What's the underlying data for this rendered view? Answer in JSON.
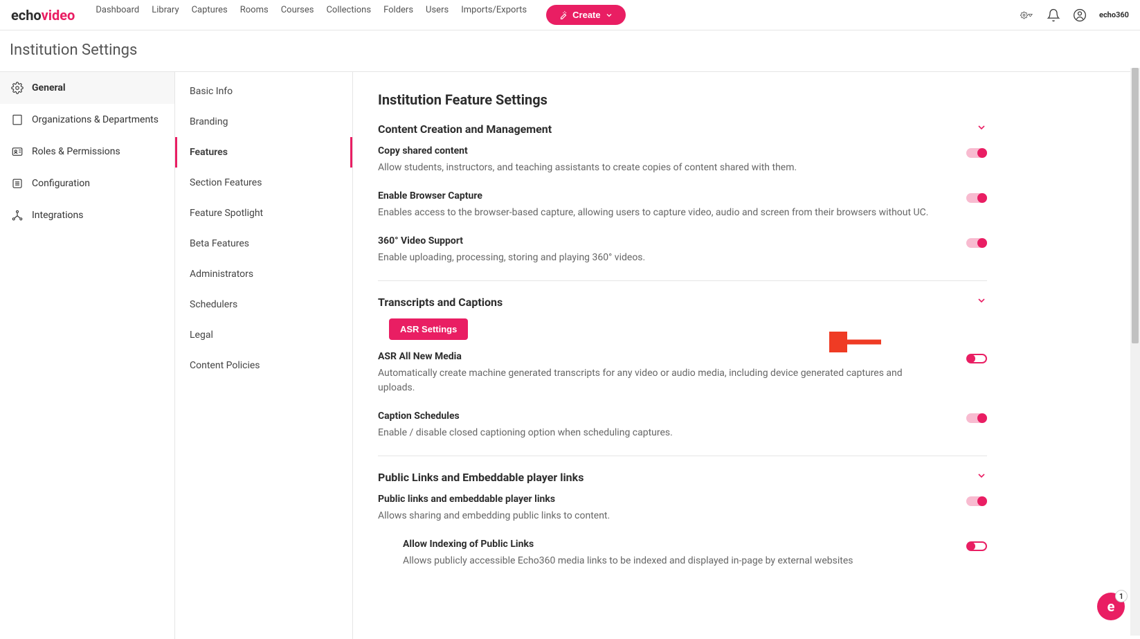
{
  "header": {
    "logo_part1": "echo",
    "logo_part2": "video",
    "nav": [
      "Dashboard",
      "Library",
      "Captures",
      "Rooms",
      "Courses",
      "Collections",
      "Folders",
      "Users",
      "Imports/Exports"
    ],
    "create_label": "Create",
    "brand_mini_1": "echo",
    "brand_mini_2": "360"
  },
  "page_title": "Institution Settings",
  "sidebar1": {
    "items": [
      "General",
      "Organizations & Departments",
      "Roles & Permissions",
      "Configuration",
      "Integrations"
    ],
    "active_index": 0
  },
  "sidebar2": {
    "items": [
      "Basic Info",
      "Branding",
      "Features",
      "Section Features",
      "Feature Spotlight",
      "Beta Features",
      "Administrators",
      "Schedulers",
      "Legal",
      "Content Policies"
    ],
    "active_index": 2
  },
  "main": {
    "title": "Institution Feature Settings",
    "sections": [
      {
        "title": "Content Creation and Management",
        "settings": [
          {
            "title": "Copy shared content",
            "desc": "Allow students, instructors, and teaching assistants to create copies of content shared with them.",
            "on": true
          },
          {
            "title": "Enable Browser Capture",
            "desc": "Enables access to the browser-based capture, allowing users to capture video, audio and screen from their browsers without UC.",
            "on": true
          },
          {
            "title": "360° Video Support",
            "desc": "Enable uploading, processing, storing and playing 360° videos.",
            "on": true
          }
        ]
      },
      {
        "title": "Transcripts and Captions",
        "asr_button": "ASR Settings",
        "settings": [
          {
            "title": "ASR All New Media",
            "desc": "Automatically create machine generated transcripts for any video or audio media, including device generated captures and uploads.",
            "on": false
          },
          {
            "title": "Caption Schedules",
            "desc": "Enable / disable closed captioning option when scheduling captures.",
            "on": true
          }
        ]
      },
      {
        "title": "Public Links and Embeddable player links",
        "settings": [
          {
            "title": "Public links and embeddable player links",
            "desc": "Allows sharing and embedding public links to content.",
            "on": true
          },
          {
            "title": "Allow Indexing of Public Links",
            "desc": "Allows publicly accessible Echo360 media links to be indexed and displayed in-page by external websites",
            "on": false,
            "indent": true
          }
        ]
      }
    ]
  },
  "help_badge": "1"
}
